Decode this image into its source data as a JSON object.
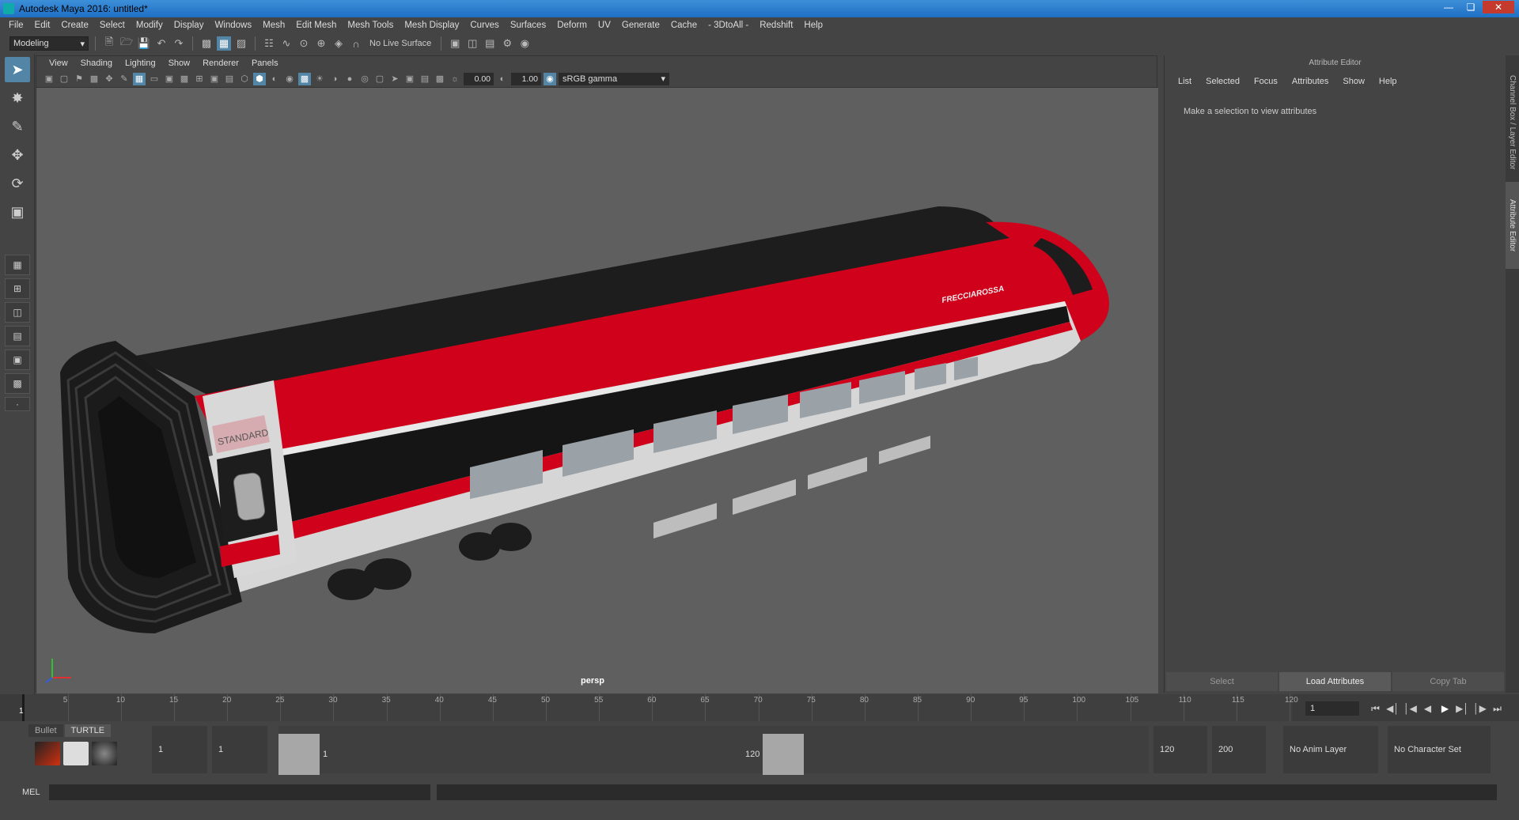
{
  "window": {
    "title": "Autodesk Maya 2016: untitled*"
  },
  "menubar": [
    "File",
    "Edit",
    "Create",
    "Select",
    "Modify",
    "Display",
    "Windows",
    "Mesh",
    "Edit Mesh",
    "Mesh Tools",
    "Mesh Display",
    "Curves",
    "Surfaces",
    "Deform",
    "UV",
    "Generate",
    "Cache",
    "- 3DtoAll -",
    "Redshift",
    "Help"
  ],
  "toolbar": {
    "mode": "Modeling",
    "live_surface": "No Live Surface"
  },
  "viewport": {
    "menu": [
      "View",
      "Shading",
      "Lighting",
      "Show",
      "Renderer",
      "Panels"
    ],
    "exposure": "0.00",
    "gamma": "1.00",
    "colorspace": "sRGB gamma",
    "camera": "persp",
    "decal_standard": "STANDARD",
    "decal_brand": "FRECCIAROSSA"
  },
  "attribute_editor": {
    "title": "Attribute Editor",
    "menu": [
      "List",
      "Selected",
      "Focus",
      "Attributes",
      "Show",
      "Help"
    ],
    "message": "Make a selection to view attributes",
    "buttons": [
      "Select",
      "Load Attributes",
      "Copy Tab"
    ]
  },
  "side_tabs": [
    "Channel Box / Layer Editor",
    "Attribute Editor"
  ],
  "timeline": {
    "ticks": [
      "5",
      "10",
      "15",
      "20",
      "25",
      "30",
      "35",
      "40",
      "45",
      "50",
      "55",
      "60",
      "65",
      "70",
      "75",
      "80",
      "85",
      "90",
      "95",
      "100",
      "105",
      "110",
      "115",
      "120"
    ],
    "start_label": "1",
    "current_frame": "1"
  },
  "shelf": {
    "tabs": [
      "Bullet",
      "TURTLE"
    ]
  },
  "range": {
    "start": "1",
    "playback_start": "1",
    "slider_start": "1",
    "slider_end": "120",
    "playback_end": "120",
    "end": "200",
    "anim_layer": "No Anim Layer",
    "character_set": "No Character Set"
  },
  "command": {
    "label": "MEL"
  },
  "colors": {
    "accent": "#5285a6",
    "train_red": "#d0021b",
    "train_dark": "#1d1d1d",
    "train_white": "#d8d8d8"
  }
}
